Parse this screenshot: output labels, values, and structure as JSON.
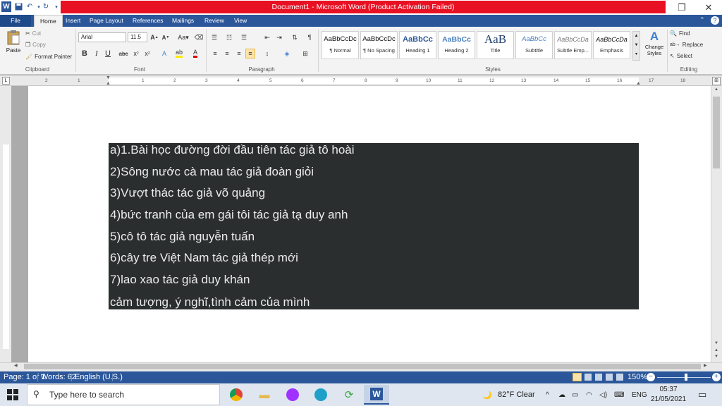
{
  "window": {
    "title": "Document1 - Microsoft Word (Product Activation Failed)",
    "word_logo_letter": "W"
  },
  "tabs": [
    "File",
    "Home",
    "Insert",
    "Page Layout",
    "References",
    "Mailings",
    "Review",
    "View"
  ],
  "ribbon": {
    "clipboard": {
      "paste": "Paste",
      "cut": "Cut",
      "copy": "Copy",
      "format_painter": "Format Painter",
      "group_label": "Clipboard"
    },
    "font": {
      "name": "Arial",
      "size": "11.5",
      "group_label": "Font"
    },
    "paragraph": {
      "group_label": "Paragraph"
    },
    "styles": {
      "group_label": "Styles",
      "items": [
        {
          "preview": "AaBbCcDc",
          "name": "¶ Normal"
        },
        {
          "preview": "AaBbCcDc",
          "name": "¶ No Spacing"
        },
        {
          "preview": "AaBbCc",
          "name": "Heading 1"
        },
        {
          "preview": "AaBbCc",
          "name": "Heading 2"
        },
        {
          "preview": "AaB",
          "name": "Title"
        },
        {
          "preview": "AaBbCc",
          "name": "Subtitle"
        },
        {
          "preview": "AaBbCcDa",
          "name": "Subtle Emp..."
        },
        {
          "preview": "AaBbCcDa",
          "name": "Emphasis"
        }
      ],
      "change_styles": "Change Styles"
    },
    "editing": {
      "find": "Find",
      "replace": "Replace",
      "select": "Select",
      "group_label": "Editing"
    }
  },
  "ruler": {
    "numbers": [
      "2",
      "1",
      "1",
      "2",
      "3",
      "4",
      "5",
      "6",
      "7",
      "8",
      "9",
      "10",
      "11",
      "12",
      "13",
      "14",
      "15",
      "16",
      "17",
      "18"
    ]
  },
  "document": {
    "lines": [
      "a)1.Bài học đường đời đầu tiên tác giả tô hoài",
      "2)Sông nước cà mau tác giả đoàn giỏi",
      "3)Vượt thác tác giả võ quảng",
      "4)bức tranh của em gái tôi tác giả tạ duy anh",
      "5)cô tô tác giả nguyễn tuấn",
      "6)cây tre Việt Nam tác giả thép mới",
      "7)lao xao tác giả duy khán",
      "cảm tượng, ý nghĩ,tình cảm của mình"
    ]
  },
  "status": {
    "page": "Page: 1 of 1",
    "words": "Words: 62",
    "language": "English (U.S.)",
    "zoom": "150%"
  },
  "taskbar": {
    "search_placeholder": "Type here to search",
    "weather": "82°F  Clear",
    "lang": "ENG",
    "time": "05:37",
    "date": "21/05/2021"
  },
  "colors": {
    "accent": "#2b579a",
    "title_bar_red": "#e81123",
    "text_highlight_bg": "#2a2e2f",
    "text_highlight_fg": "#ececec"
  }
}
